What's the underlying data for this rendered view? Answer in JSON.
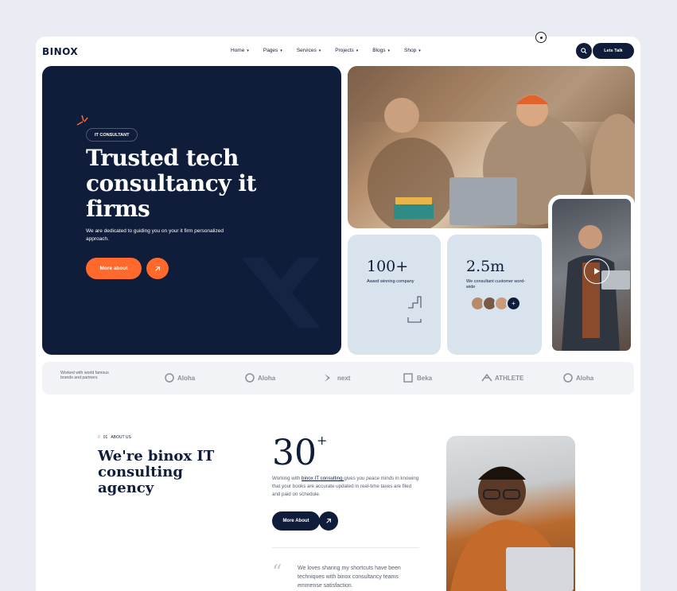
{
  "header": {
    "logo": "BINOX",
    "nav": [
      {
        "label": "Home"
      },
      {
        "label": "Pages"
      },
      {
        "label": "Services"
      },
      {
        "label": "Projects"
      },
      {
        "label": "Blogs"
      },
      {
        "label": "Shop"
      }
    ],
    "talk_label": "Lets Talk",
    "search_icon": "search-icon"
  },
  "hero": {
    "badge": "IT CONSULTANT",
    "title": "Trusted tech consultancy it firms",
    "description": "We are dedicated to guiding you on your it firm personalized approach.",
    "button_label": "More about",
    "arrow_icon": "arrow-up-right-icon"
  },
  "stats": [
    {
      "value": "100+",
      "label": "Award winning company"
    },
    {
      "value": "2.5m",
      "label": "We consultant customer word-wide"
    }
  ],
  "brands": {
    "label": "Worked with world famous brands and partners",
    "items": [
      {
        "name": "Aloha"
      },
      {
        "name": "Aloha"
      },
      {
        "name": "next"
      },
      {
        "name": "Beka"
      },
      {
        "name": "ATHLETE"
      },
      {
        "name": "Aloha"
      }
    ]
  },
  "about": {
    "tag_number": "01",
    "tag_label": "ABOUT US",
    "title": "We're binox IT consulting agency",
    "big_number": "30",
    "big_number_sup": "+",
    "desc_prefix": "Working with ",
    "desc_link": "binox IT consulting ",
    "desc_suffix": "gives you peace minds in knowing that your books are accurate updated in real-time taxes are filed and paid on schedule.",
    "button_label": "More About",
    "quote": "We loves sharing my shortcuts have been techniques with binox consultancy teams emmense satisfaction."
  },
  "colors": {
    "navy": "#0f1d3a",
    "accent": "#ff6a2c",
    "card": "#d8e3ee"
  }
}
